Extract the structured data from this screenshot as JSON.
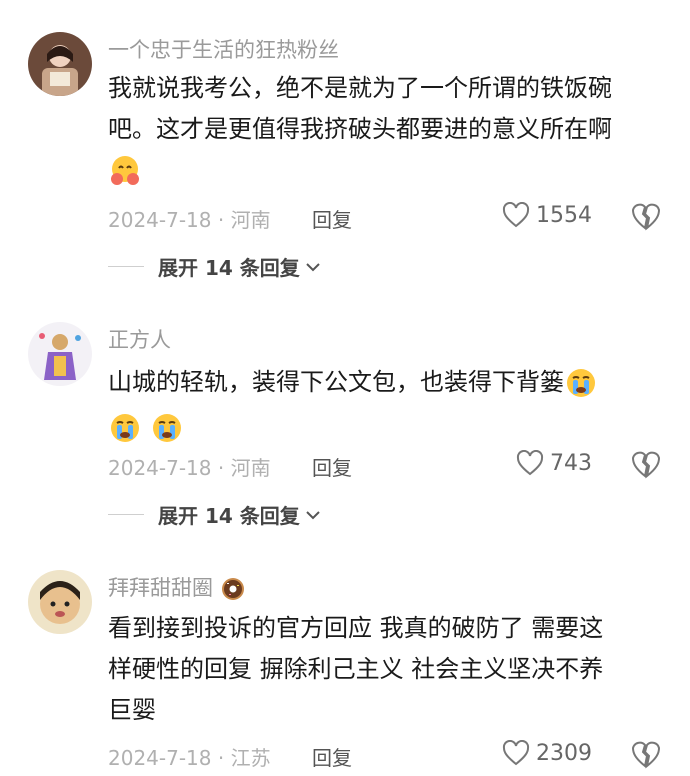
{
  "comments": [
    {
      "username": "一个忠于生活的狂热粉丝",
      "text_lines": [
        "我就说我考公，绝不是就为了一个所谓的铁饭碗",
        "吧。这才是更值得我挤破头都要进的意义所在啊"
      ],
      "emojis": [
        "hugging-face"
      ],
      "date": "2024-7-18 · 河南",
      "reply_label": "回复",
      "likes": "1554",
      "expand_label": "展开 14 条回复"
    },
    {
      "username": "正方人",
      "text_lines": [
        "山城的轻轨，装得下公文包，也装得下背篓"
      ],
      "emojis": [
        "crying-face",
        "crying-face",
        "crying-face"
      ],
      "date": "2024-7-18 · 河南",
      "reply_label": "回复",
      "likes": "743",
      "expand_label": "展开 14 条回复"
    },
    {
      "username": "拜拜甜甜圈",
      "username_emoji": "donut",
      "text_lines": [
        "看到接到投诉的官方回应 我真的破防了 需要这",
        "样硬性的回复 摒除利己主义 社会主义坚决不养",
        "巨婴"
      ],
      "date": "2024-7-18 · 江苏",
      "reply_label": "回复",
      "likes": "2309"
    }
  ]
}
